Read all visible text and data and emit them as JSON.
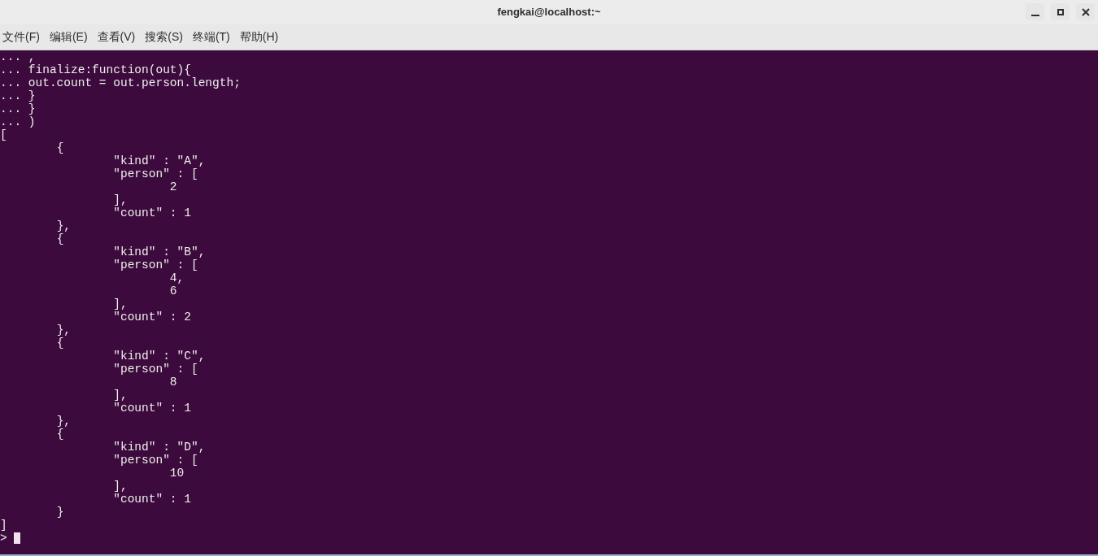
{
  "window": {
    "title": "fengkai@localhost:~",
    "controls": [
      {
        "kind": "minimize"
      },
      {
        "kind": "maximize"
      },
      {
        "kind": "close"
      }
    ]
  },
  "menu": [
    "文件(F)",
    "编辑(E)",
    "查看(V)",
    "搜索(S)",
    "终端(T)",
    "帮助(H)"
  ],
  "terminal": {
    "lines": [
      "... ,",
      "... finalize:function(out){",
      "... out.count = out.person.length;",
      "... }",
      "... }",
      "... )",
      "[",
      "\t{",
      "\t\t\"kind\" : \"A\",",
      "\t\t\"person\" : [",
      "\t\t\t2",
      "\t\t],",
      "\t\t\"count\" : 1",
      "\t},",
      "\t{",
      "\t\t\"kind\" : \"B\",",
      "\t\t\"person\" : [",
      "\t\t\t4,",
      "\t\t\t6",
      "\t\t],",
      "\t\t\"count\" : 2",
      "\t},",
      "\t{",
      "\t\t\"kind\" : \"C\",",
      "\t\t\"person\" : [",
      "\t\t\t8",
      "\t\t],",
      "\t\t\"count\" : 1",
      "\t},",
      "\t{",
      "\t\t\"kind\" : \"D\",",
      "\t\t\"person\" : [",
      "\t\t\t10",
      "\t\t],",
      "\t\t\"count\" : 1",
      "\t}",
      "]"
    ],
    "prompt": ">"
  }
}
